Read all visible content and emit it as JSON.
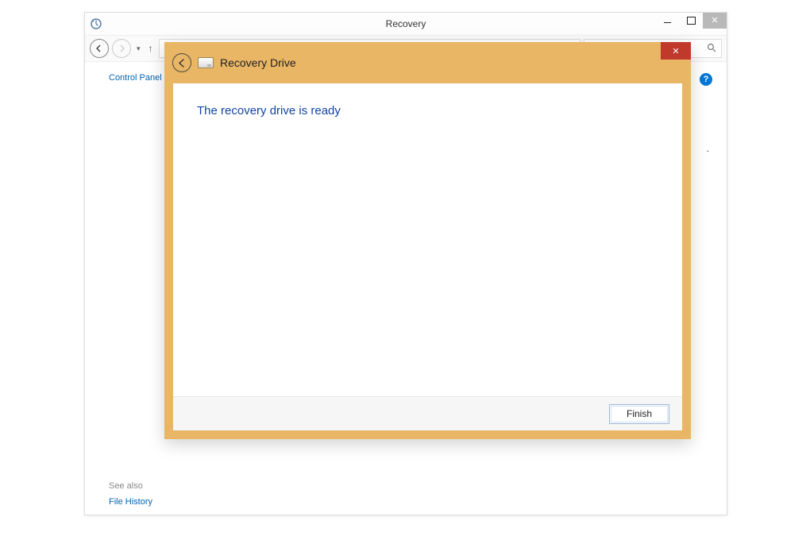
{
  "explorer": {
    "title": "Recovery",
    "breadcrumb": "Control Panel",
    "see_also_label": "See also",
    "see_also_link": "File History",
    "help_icon_label": "?",
    "partial_text": "."
  },
  "wizard": {
    "title": "Recovery Drive",
    "heading": "The recovery drive is ready",
    "finish_label": "Finish",
    "close_glyph": "✕"
  },
  "glyphs": {
    "dropdown_caret": "▾",
    "up_arrow": "↑"
  }
}
